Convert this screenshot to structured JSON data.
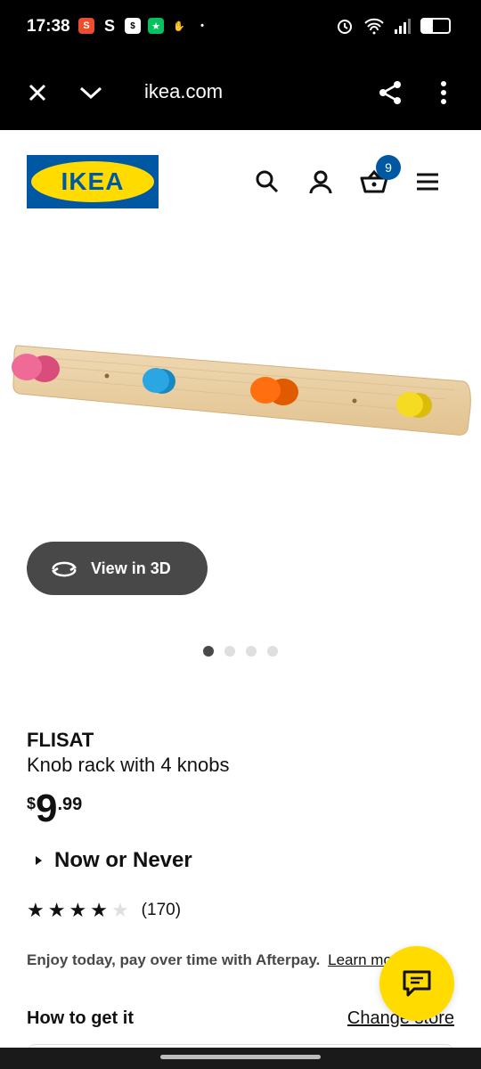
{
  "status_bar": {
    "time": "17:38",
    "battery": "8",
    "icons_left": [
      "shopee-icon",
      "s-icon",
      "shopping-bag-icon",
      "wechat-icon",
      "hand-icon",
      "dot-icon"
    ],
    "icons_right": [
      "alarm-icon",
      "wifi-icon",
      "signal-icon",
      "battery-icon"
    ]
  },
  "browser": {
    "url": "ikea.com",
    "close_icon": "close-icon",
    "collapse_icon": "chevron-down-icon",
    "share_icon": "share-icon",
    "menu_icon": "more-vertical-icon"
  },
  "header": {
    "logo_text": "IKEA",
    "cart_count": "9",
    "colors": {
      "ikea_blue": "#0058a3",
      "ikea_yellow": "#ffdb00"
    }
  },
  "gallery": {
    "view3d_label": "View in 3D",
    "dot_count": 4,
    "active_dot": 0,
    "knob_colors": [
      "#e85a8c",
      "#1ea0dc",
      "#ff6a00",
      "#f2d416"
    ]
  },
  "product": {
    "name": "FLISAT",
    "description": "Knob rack with 4 knobs",
    "price_currency": "$",
    "price_integer": "9",
    "price_decimal": ".99",
    "badge": "Now or Never",
    "rating_value": 4,
    "rating_max": 5,
    "rating_count": "(170)",
    "afterpay_text": "Enjoy today, pay over time with Afterpay.",
    "afterpay_link": "Learn more"
  },
  "delivery": {
    "title": "How to get it",
    "change_store": "Change store"
  }
}
